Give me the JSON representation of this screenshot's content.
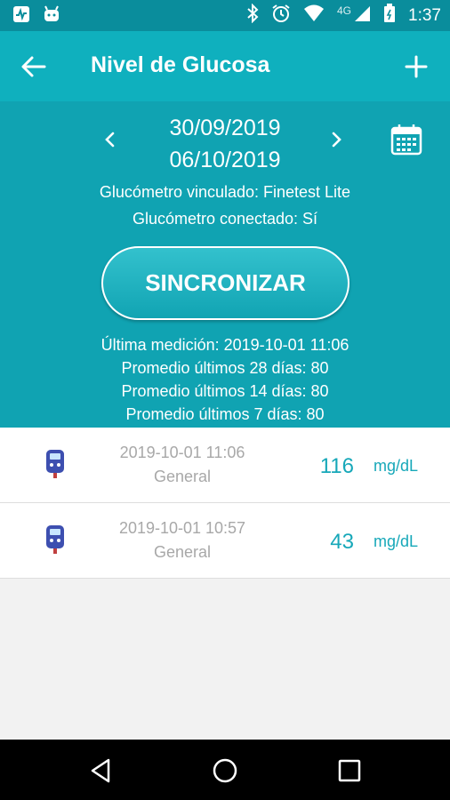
{
  "status_bar": {
    "network": "4G",
    "clock": "1:37"
  },
  "app_bar": {
    "title": "Nivel de Glucosa"
  },
  "date_range": {
    "start": "30/09/2019",
    "end": "06/10/2019"
  },
  "glucometer": {
    "linked": "Glucómetro vinculado: Finetest Lite",
    "connected": "Glucómetro conectado: Sí"
  },
  "sync_button": "SINCRONIZAR",
  "stats": {
    "last": "Última medición: 2019-10-01 11:06",
    "avg28": "Promedio últimos 28 días: 80",
    "avg14": "Promedio últimos 14 días: 80",
    "avg7": "Promedio últimos 7 días: 80"
  },
  "readings": [
    {
      "timestamp": "2019-10-01 11:06",
      "category": "General",
      "value": "116",
      "unit": "mg/dL"
    },
    {
      "timestamp": "2019-10-01 10:57",
      "category": "General",
      "value": "43",
      "unit": "mg/dL"
    }
  ],
  "colors": {
    "primary": "#0fb0be",
    "header": "#10a3b2",
    "status": "#0a8d9c",
    "accent": "#17a8b9"
  }
}
